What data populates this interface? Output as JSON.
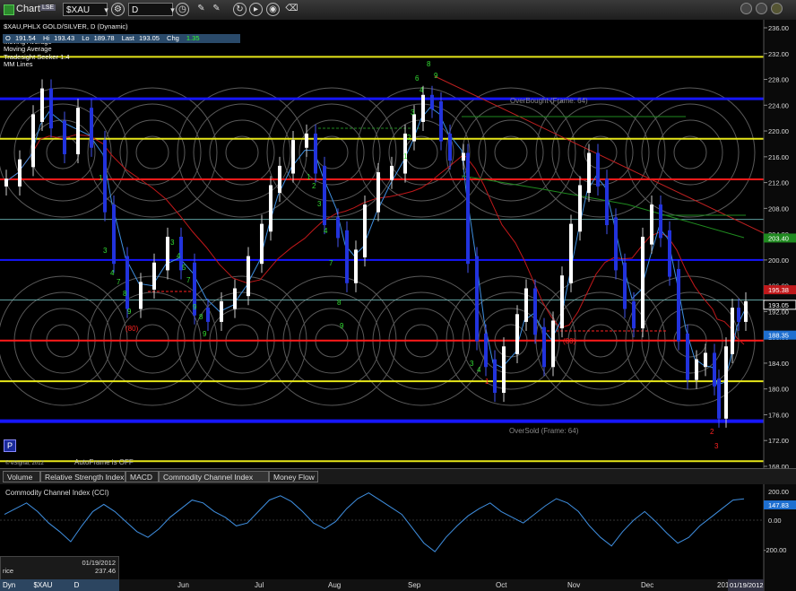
{
  "toolbar": {
    "title": "Chart",
    "badge": "LSE",
    "symbol": "$XAU",
    "interval": "D",
    "icons": [
      "link-icon",
      "settings-icon",
      "refresh-icon",
      "pencil-icon",
      "draw-icon",
      "trend-icon",
      "play-icon",
      "clock-icon",
      "eraser-icon"
    ]
  },
  "chart_header": {
    "title": "$XAU,PHLX GOLD/SILVER, D (Dynamic)",
    "studies": [
      "Moving Average",
      "Moving Average",
      "Tradesight Seeker 1.4",
      "MM Lines"
    ],
    "quote": {
      "open_label": "O",
      "open": "191.54",
      "high_label": "Hi",
      "high": "193.43",
      "low_label": "Lo",
      "low": "189.78",
      "last_label": "Last",
      "last": "193.05",
      "chg_label": "Chg",
      "chg": "1.35"
    }
  },
  "price_axis": {
    "ticks": [
      "236.00",
      "232.00",
      "228.00",
      "224.00",
      "220.00",
      "216.00",
      "212.00",
      "208.00",
      "204.00",
      "200.00",
      "196.00",
      "192.00",
      "188.00",
      "184.00",
      "180.00",
      "176.00",
      "172.00",
      "168.00"
    ],
    "badges": [
      {
        "label": "203.40",
        "color": "#1f8a1f"
      },
      {
        "label": "195.38",
        "color": "#c0181a"
      },
      {
        "label": "193.05",
        "color": "#ffffff"
      },
      {
        "label": "188.35",
        "color": "#1e6fd0"
      }
    ]
  },
  "annotations": {
    "overbought": "OverBought (Frame: 64)",
    "oversold": "OverSold (Frame: 64)",
    "autoframe": "AutoFrame is OFF",
    "copyright": "© eSignal, 2012",
    "p_button": "P",
    "label_80a": "(80)",
    "label_80b": "(80)"
  },
  "chart_numbers": [
    "8",
    "6",
    "9",
    "4",
    "3",
    "2",
    "1",
    "9",
    "8",
    "9",
    "7",
    "5",
    "4",
    "3",
    "9",
    "8",
    "7",
    "4",
    "3",
    "1",
    "9",
    "8",
    "7",
    "4",
    "3",
    "2",
    "1",
    "3",
    "4",
    "1",
    "2",
    "3"
  ],
  "time_axis": [
    "May",
    "Jun",
    "Jul",
    "Aug",
    "Sep",
    "Oct",
    "Nov",
    "Dec",
    "2012"
  ],
  "time_cursor": "01/19/2012",
  "tabs": [
    "Volume",
    "Relative Strength Index",
    "MACD",
    "Commodity Channel Index (CCI)",
    "Money Flow"
  ],
  "cci_panel": {
    "title": "Commodity Channel Index (CCI)",
    "ticks": [
      "200.00",
      "0.00",
      "-200.00"
    ],
    "value_badge": "147.83"
  },
  "status": {
    "date_value": "01/19/2012",
    "price_label": "rice",
    "price_value": "237.46",
    "dyn_label": "Dyn",
    "dyn_symbol": "$XAU",
    "dyn_interval": "D"
  },
  "colors": {
    "blue_level": "#1616ff",
    "red_level": "#ff1a1a",
    "yellow_level": "#e6e61a",
    "teal_level": "#5fa0a0",
    "candle_up": "#ffffff",
    "candle_down": "#2233dd",
    "ma_red": "#c0181a",
    "ma_green": "#1f8a1f",
    "cci_line": "#3f8fe0",
    "seeker_green": "#33dd33"
  }
}
